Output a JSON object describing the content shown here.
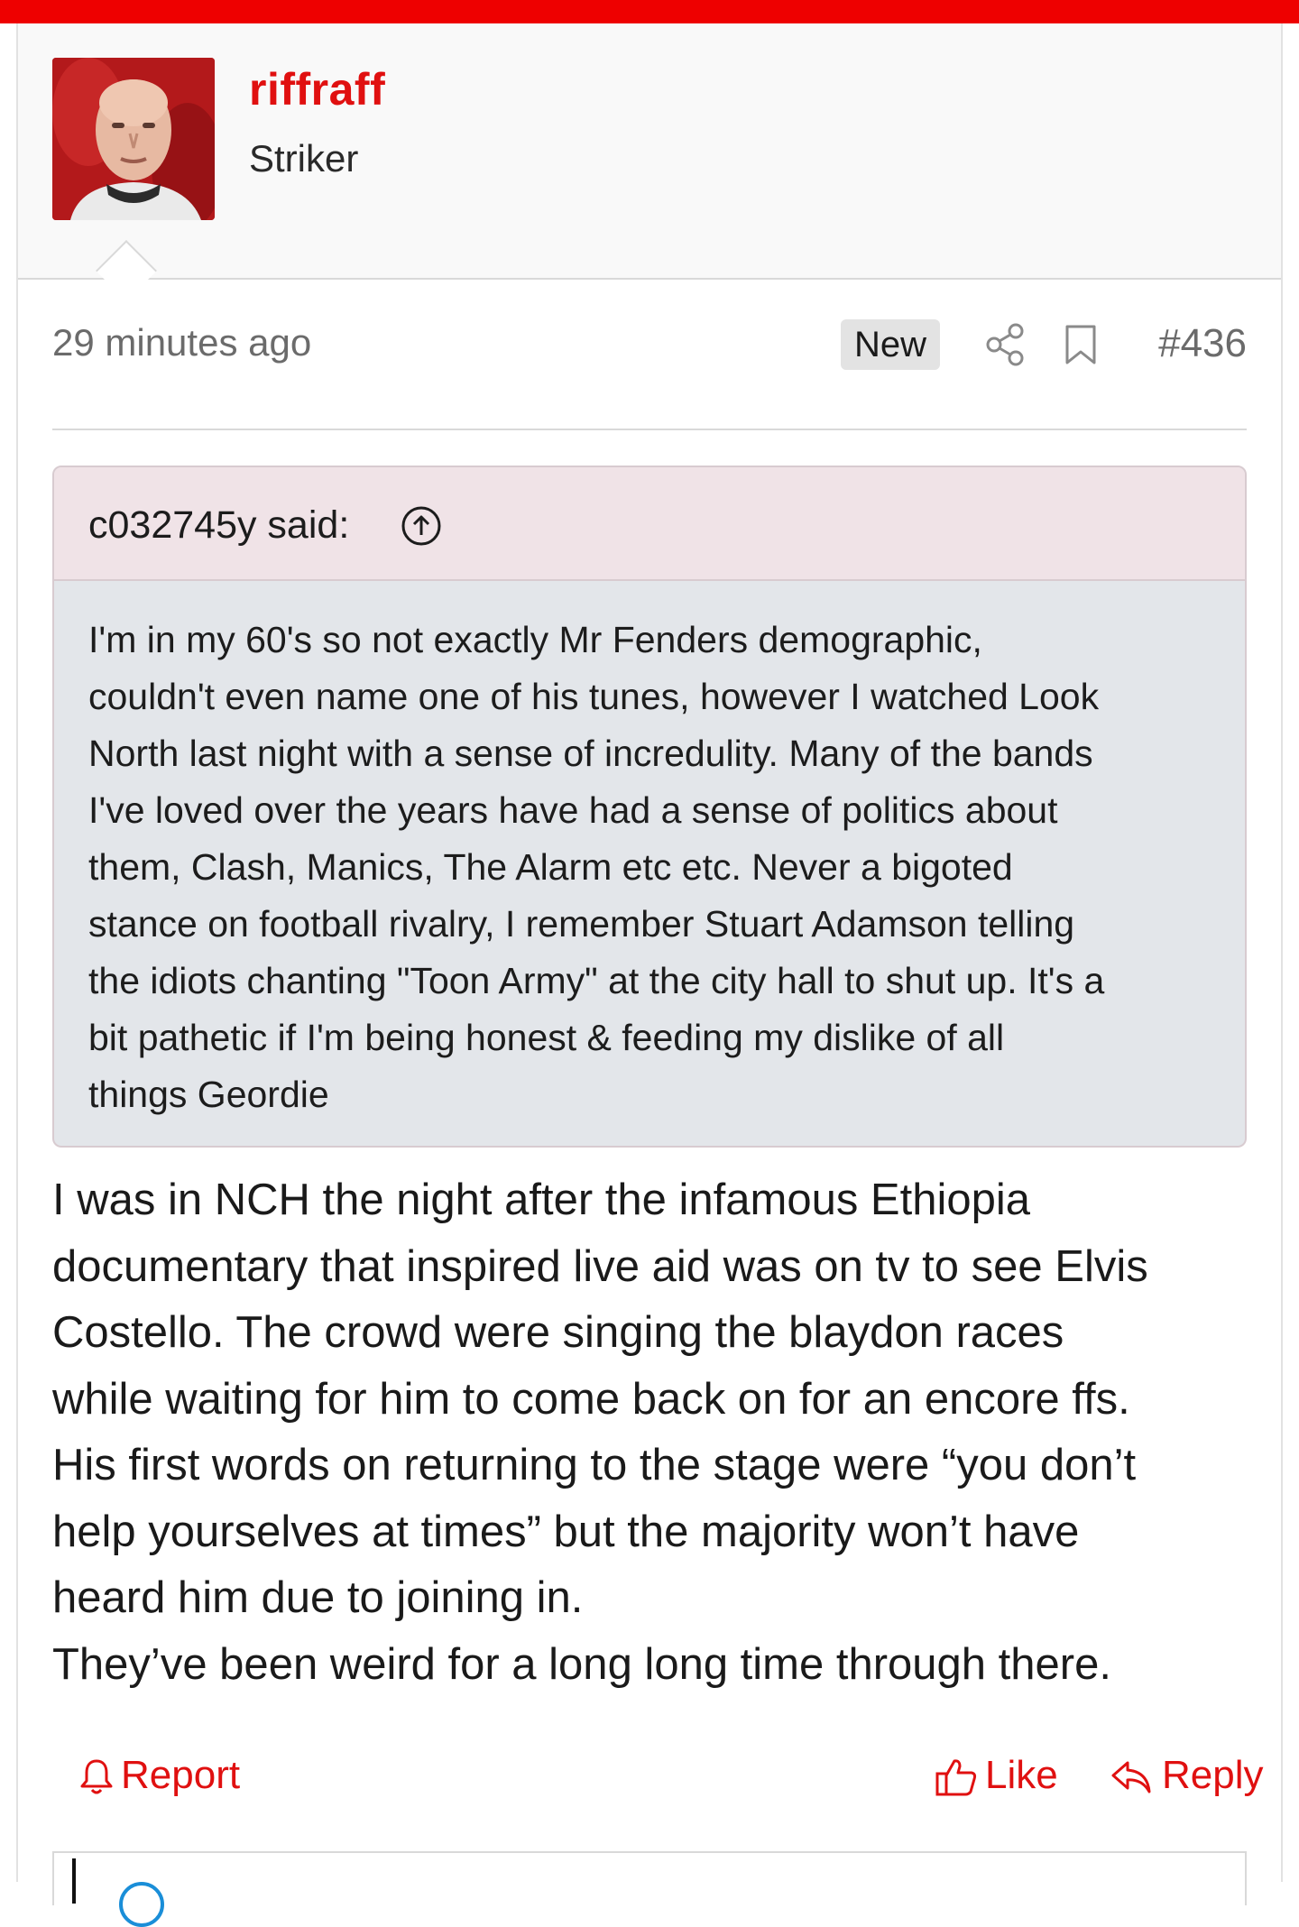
{
  "colors": {
    "accent": "#e01010",
    "top_bar": "#ee0000",
    "quote_header_bg": "#f0e3e7",
    "quote_body_bg": "#e3e6ea"
  },
  "user": {
    "name": "riffraff",
    "title": "Striker"
  },
  "meta": {
    "timestamp": "29 minutes ago",
    "badge": "New",
    "post_number": "#436"
  },
  "quote": {
    "author": "c032745y said:",
    "lines": [
      "I'm in my 60's so not exactly Mr Fenders demographic,",
      "couldn't even name one of his tunes, however I watched Look",
      "North last night with a sense of incredulity. Many of the bands",
      "I've loved over the years have had a sense of politics about",
      "them, Clash, Manics, The Alarm etc etc. Never a bigoted",
      "stance on football rivalry, I remember Stuart Adamson telling",
      "the idiots chanting \"Toon Army\" at the city hall to shut up. It's a",
      "bit pathetic if I'm being honest & feeding my dislike of all",
      "things Geordie"
    ]
  },
  "message": {
    "lines": [
      "I was in NCH the night after the infamous Ethiopia",
      "documentary that inspired live aid was on tv to see Elvis",
      "Costello. The crowd were singing the blaydon races",
      "while waiting for him to come back on for an encore ffs.",
      "His first words on returning to the stage were “you don’t",
      "help yourselves at times” but the majority won’t have",
      "heard him due to joining in.",
      "They’ve been weird for a long long time through there."
    ]
  },
  "actions": {
    "report": "Report",
    "like": "Like",
    "reply": "Reply"
  },
  "icons": [
    "bell-icon",
    "share-icon",
    "bookmark-icon",
    "arrow-up-circle-icon",
    "thumbs-up-icon",
    "reply-arrow-icon"
  ]
}
